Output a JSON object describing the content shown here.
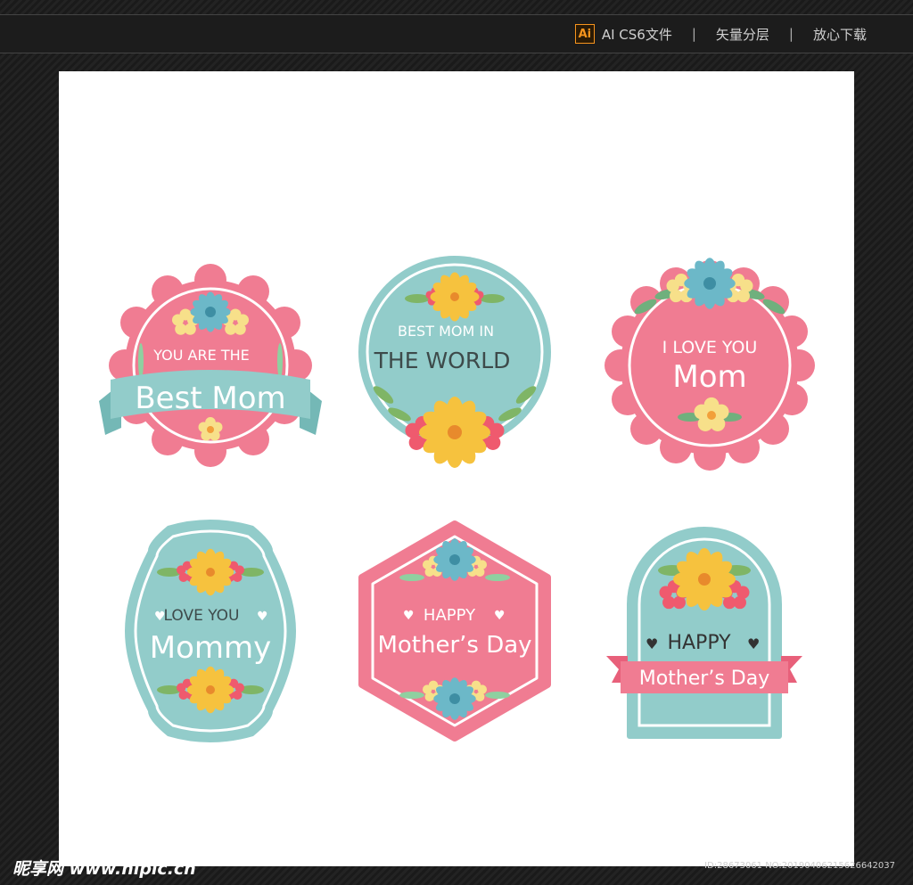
{
  "header": {
    "ai_icon_label": "Ai",
    "format_label": "AI CS6文件",
    "separator": "|",
    "layers_label": "矢量分层",
    "download_label": "放心下载"
  },
  "badges": {
    "b1": {
      "line1": "YOU ARE THE",
      "line2": "Best Mom"
    },
    "b2": {
      "line1": "BEST MOM IN",
      "line2": "THE WORLD"
    },
    "b3": {
      "line1": "I LOVE YOU",
      "line2": "Mom"
    },
    "b4": {
      "heart": "♥",
      "line1": "LOVE YOU",
      "line2": "Mommy"
    },
    "b5": {
      "heart": "♥",
      "line1": "HAPPY",
      "line2": "Mother’s Day"
    },
    "b6": {
      "heart": "♥",
      "line1": "HAPPY",
      "line2": "Mother’s Day"
    }
  },
  "colors": {
    "pink": "#f07c92",
    "teal": "#92ccca",
    "white": "#ffffff",
    "dark_text": "#333333"
  },
  "watermark": {
    "site": "昵享网 www.nipic.cn",
    "id": "ID:28673061 NO:20190406215626642037"
  }
}
